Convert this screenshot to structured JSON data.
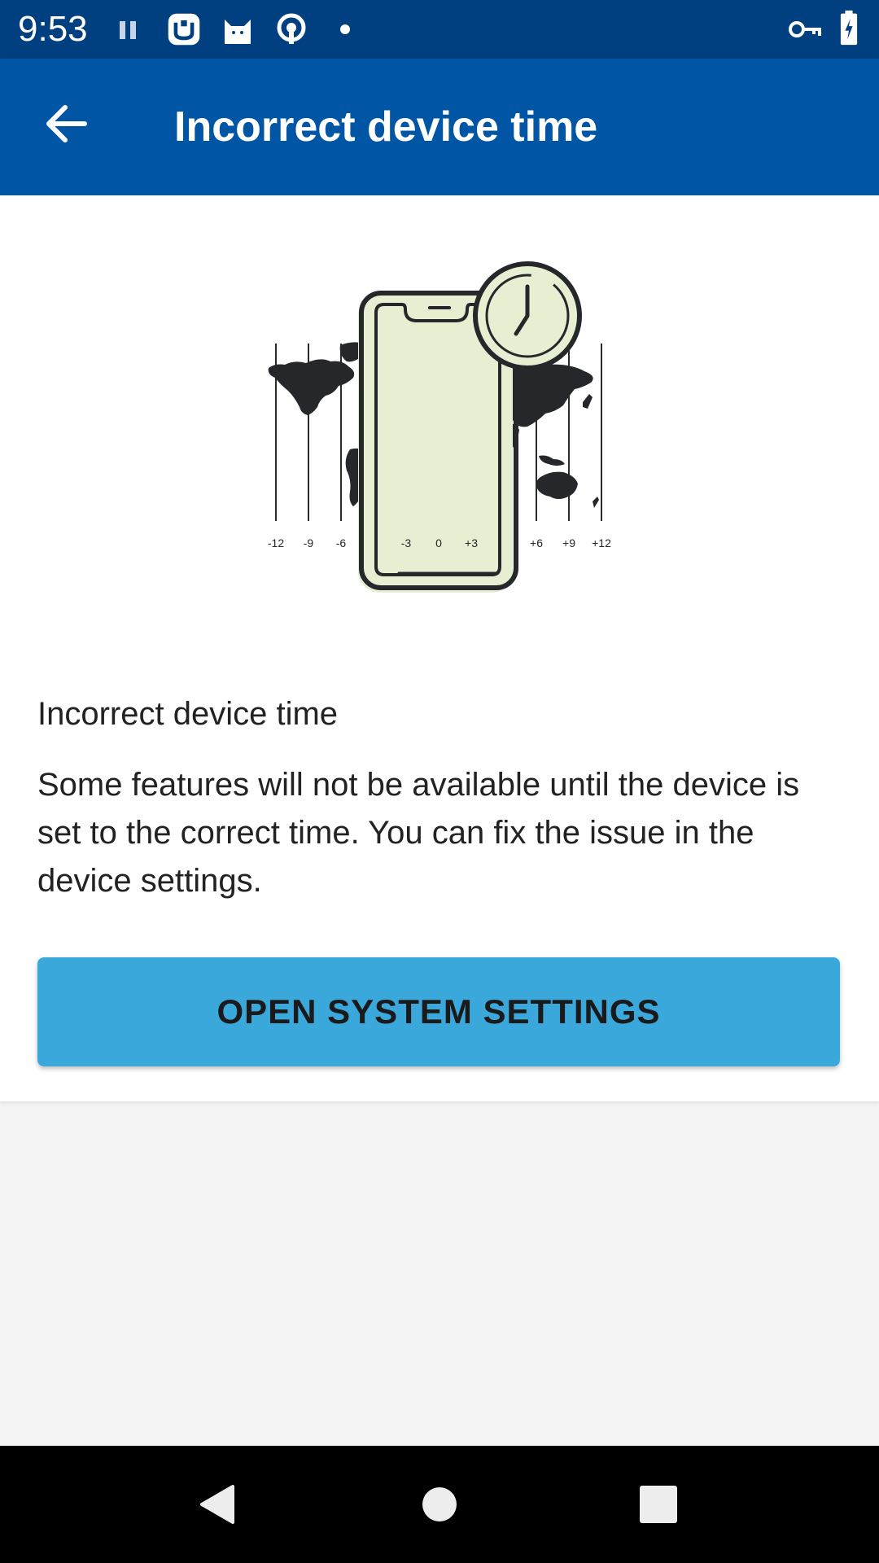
{
  "status_bar": {
    "time": "9:53",
    "left_icons": [
      "pause-icon",
      "app-badge-icon",
      "cat-icon",
      "podcast-icon",
      "notification-dot-icon"
    ],
    "right_icons": [
      "vpn-key-icon",
      "battery-charging-icon"
    ]
  },
  "app_bar": {
    "title": "Incorrect device time",
    "back_icon": "arrow-back-icon"
  },
  "illustration": {
    "timezone_labels": [
      "-12",
      "-9",
      "-6",
      "-3",
      "0",
      "+3",
      "+6",
      "+9",
      "+12"
    ]
  },
  "content": {
    "heading": "Incorrect device time",
    "body": "Some features will not be available until the device is set to the correct time. You can fix the issue in the device settings.",
    "button_label": "OPEN SYSTEM SETTINGS"
  },
  "colors": {
    "status_bar": "#003f80",
    "app_bar": "#0055a5",
    "button": "#3ba8dc",
    "background": "#f3f3f3",
    "accent_light": "#e6efd2"
  },
  "nav_bar": {
    "icons": [
      "back-triangle-icon",
      "home-circle-icon",
      "recents-square-icon"
    ]
  }
}
